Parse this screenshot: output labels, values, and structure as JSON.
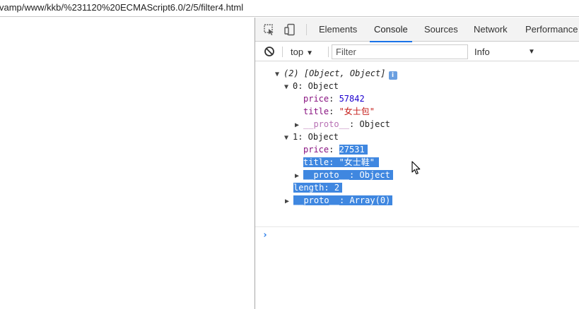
{
  "browser": {
    "url_text": "vamp/www/kkb/%231120%20ECMAScript6.0/2/5/filter4.html"
  },
  "devtools": {
    "icons": {
      "inspect": "element-picker-icon",
      "device": "device-toolbar-icon"
    },
    "tabs": [
      {
        "label": "Elements",
        "active": false
      },
      {
        "label": "Console",
        "active": true
      },
      {
        "label": "Sources",
        "active": false
      },
      {
        "label": "Network",
        "active": false
      },
      {
        "label": "Performance",
        "active": false
      }
    ],
    "console_toolbar": {
      "clear_icon": "clear-console-icon",
      "context": "top",
      "filter_placeholder": "Filter",
      "level": "Info"
    },
    "output": {
      "array_summary": "(2) [Object, Object]",
      "info_badge": "i",
      "item0": {
        "header": "0: Object",
        "price_key": "price",
        "price_value": "57842",
        "title_key": "title",
        "title_value": "\"女士包\"",
        "proto_key": "__proto__",
        "proto_value": ": Object"
      },
      "item1": {
        "header": "1: Object",
        "price_key": "price",
        "price_value": "27531",
        "title_key": "title",
        "title_value": "\"女士鞋\"",
        "proto_key": "__proto__",
        "proto_value": ": Object"
      },
      "length_key": "length",
      "length_value": "2",
      "array_proto_key": "__proto__",
      "array_proto_value": ": Array(0)"
    },
    "prompt_symbol": "›"
  },
  "colors": {
    "selection": "#3f87e0",
    "active_tab_underline": "#1a73e8",
    "key": "#881280",
    "number": "#1c00cf",
    "string": "#c41a16"
  }
}
